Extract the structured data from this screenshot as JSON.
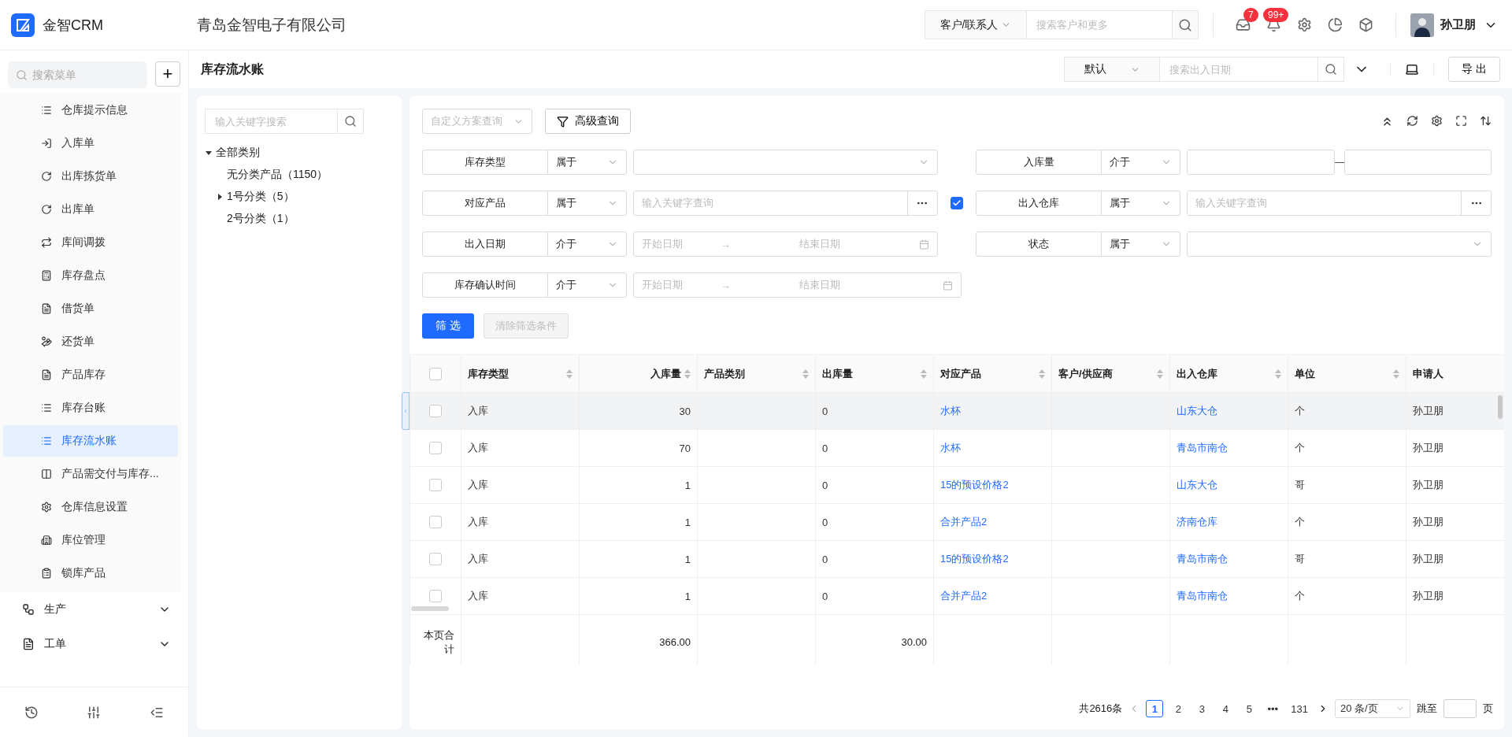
{
  "header": {
    "logo_text": "金智CRM",
    "company": "青岛金智电子有限公司",
    "search_scope": "客户/联系人",
    "search_placeholder": "搜索客户和更多",
    "inbox_badge": "7",
    "bell_badge": "99+",
    "user_name": "孙卫朋"
  },
  "sidebar": {
    "search_placeholder": "搜索菜单",
    "add_symbol": "+",
    "items": [
      {
        "label": "仓库提示信息",
        "selected": false
      },
      {
        "label": "入库单",
        "selected": false
      },
      {
        "label": "出库拣货单",
        "selected": false
      },
      {
        "label": "出库单",
        "selected": false
      },
      {
        "label": "库间调拨",
        "selected": false
      },
      {
        "label": "库存盘点",
        "selected": false
      },
      {
        "label": "借货单",
        "selected": false
      },
      {
        "label": "还货单",
        "selected": false
      },
      {
        "label": "产品库存",
        "selected": false
      },
      {
        "label": "库存台账",
        "selected": false
      },
      {
        "label": "库存流水账",
        "selected": true
      },
      {
        "label": "产品需交付与库存...",
        "selected": false
      },
      {
        "label": "仓库信息设置",
        "selected": false
      },
      {
        "label": "库位管理",
        "selected": false
      },
      {
        "label": "锁库产品",
        "selected": false
      }
    ],
    "groups": [
      {
        "label": "生产",
        "expanded": false
      },
      {
        "label": "工单",
        "expanded": false
      }
    ]
  },
  "page": {
    "title": "库存流水账",
    "view_select": "默认",
    "search_placeholder": "搜索出入日期",
    "export_button": "导 出"
  },
  "tree": {
    "search_placeholder": "输入关键字搜索",
    "nodes": [
      {
        "label": "全部类别",
        "expanded": true,
        "children": [
          {
            "label": "无分类产品（1150）"
          },
          {
            "label": "1号分类（5）",
            "expanded": false
          },
          {
            "label": "2号分类（1）"
          }
        ]
      }
    ]
  },
  "query": {
    "scheme_placeholder": "自定义方案查询",
    "advanced_button": "高级查询",
    "filters": [
      [
        {
          "label": "库存类型",
          "operator": "属于",
          "kind": "select"
        },
        {
          "label": "入库量",
          "operator": "介于",
          "kind": "range"
        }
      ],
      [
        {
          "label": "对应产品",
          "operator": "属于",
          "kind": "lookup",
          "placeholder": "输入关键字查询",
          "checked": true
        },
        {
          "label": "出入仓库",
          "operator": "属于",
          "kind": "lookup",
          "placeholder": "输入关键字查询"
        }
      ],
      [
        {
          "label": "出入日期",
          "operator": "介于",
          "kind": "date",
          "start": "开始日期",
          "separator": "→",
          "end": "结束日期"
        },
        {
          "label": "状态",
          "operator": "属于",
          "kind": "select"
        }
      ],
      [
        {
          "label": "库存确认时间",
          "operator": "介于",
          "kind": "date",
          "start": "开始日期",
          "separator": "→",
          "end": "结束日期"
        }
      ]
    ],
    "filter_button": "筛 选",
    "clear_button": "清除筛选条件",
    "clear_disabled": true
  },
  "table": {
    "all_checked": false,
    "columns": [
      {
        "label": "库存类型",
        "kind": "text",
        "sortable": true
      },
      {
        "label": "入库量",
        "kind": "number",
        "sortable": true
      },
      {
        "label": "产品类别",
        "kind": "text",
        "sortable": true
      },
      {
        "label": "出库量",
        "kind": "text",
        "sortable": true
      },
      {
        "label": "对应产品",
        "kind": "link",
        "sortable": true
      },
      {
        "label": "客户/供应商",
        "kind": "text",
        "sortable": true
      },
      {
        "label": "出入仓库",
        "kind": "link",
        "sortable": true
      },
      {
        "label": "单位",
        "kind": "text",
        "sortable": true
      },
      {
        "label": "申请人",
        "kind": "text"
      }
    ],
    "rows": [
      {
        "checked": false,
        "highlighted": true,
        "cells": [
          "入库",
          "30",
          "",
          "0",
          "水杯",
          "",
          "山东大仓",
          "个",
          "孙卫朋"
        ]
      },
      {
        "checked": false,
        "highlighted": false,
        "cells": [
          "入库",
          "70",
          "",
          "0",
          "水杯",
          "",
          "青岛市南仓",
          "个",
          "孙卫朋"
        ]
      },
      {
        "checked": false,
        "highlighted": false,
        "cells": [
          "入库",
          "1",
          "",
          "0",
          "15的预设价格2",
          "",
          "山东大仓",
          "哥",
          "孙卫朋"
        ]
      },
      {
        "checked": false,
        "highlighted": false,
        "cells": [
          "入库",
          "1",
          "",
          "0",
          "合并产品2",
          "",
          "济南仓库",
          "个",
          "孙卫朋"
        ]
      },
      {
        "checked": false,
        "highlighted": false,
        "cells": [
          "入库",
          "1",
          "",
          "0",
          "15的预设价格2",
          "",
          "青岛市南仓",
          "哥",
          "孙卫朋"
        ]
      },
      {
        "checked": false,
        "highlighted": false,
        "cells": [
          "入库",
          "1",
          "",
          "0",
          "合并产品2",
          "",
          "青岛市南仓",
          "个",
          "孙卫朋"
        ]
      }
    ],
    "totals": {
      "label": "本页合计",
      "cells": [
        "",
        "366.00",
        "",
        "30.00",
        "",
        "",
        "",
        "",
        ""
      ]
    }
  },
  "pagination": {
    "total": "共2616条",
    "pages": [
      {
        "label": "1",
        "selected": true
      },
      {
        "label": "2",
        "selected": false
      },
      {
        "label": "3",
        "selected": false
      },
      {
        "label": "4",
        "selected": false
      },
      {
        "label": "5",
        "selected": false
      },
      {
        "label": "•••",
        "selected": false
      },
      {
        "label": "131",
        "selected": false
      }
    ],
    "page_size": "20 条/页",
    "jump_label": "跳至",
    "page_suffix": "页"
  }
}
